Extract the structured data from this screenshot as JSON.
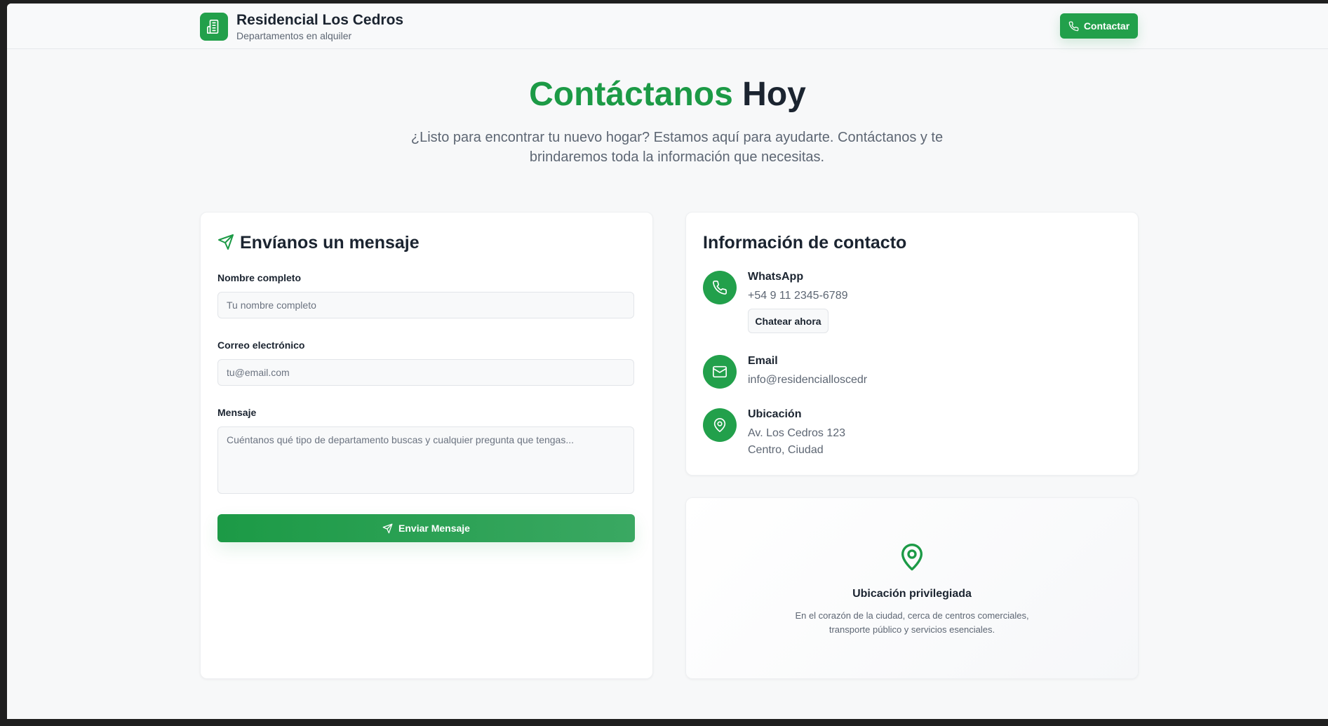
{
  "header": {
    "brand_title": "Residencial Los Cedros",
    "brand_subtitle": "Departamentos en alquiler",
    "contact_button": "Contactar"
  },
  "hero": {
    "title_green": "Contáctanos",
    "title_dark": "Hoy",
    "subtitle": "¿Listo para encontrar tu nuevo hogar? Estamos aquí para ayudarte. Contáctanos y te brindaremos toda la información que necesitas."
  },
  "form": {
    "title": "Envíanos un mensaje",
    "name_label": "Nombre completo",
    "name_placeholder": "Tu nombre completo",
    "email_label": "Correo electrónico",
    "email_placeholder": "tu@email.com",
    "message_label": "Mensaje",
    "message_placeholder": "Cuéntanos qué tipo de departamento buscas y cualquier pregunta que tengas...",
    "submit_label": "Enviar Mensaje"
  },
  "contact_info": {
    "title": "Información de contacto",
    "whatsapp_label": "WhatsApp",
    "whatsapp_value": "+54 9 11 2345-6789",
    "chat_button": "Chatear ahora",
    "email_label": "Email",
    "email_value": "info@residencialloscedr",
    "location_label": "Ubicación",
    "location_line1": "Av. Los Cedros 123",
    "location_line2": "Centro, Ciudad"
  },
  "location_card": {
    "title": "Ubicación privilegiada",
    "text": "En el corazón de la ciudad, cerca de centros comerciales, transporte público y servicios esenciales."
  },
  "colors": {
    "accent": "#22a04b",
    "title_green": "#1c9a46",
    "text_dark": "#1b2430",
    "text_muted": "#5d6673"
  },
  "icons": {
    "logo": "building-icon",
    "contact": "phone-icon",
    "send": "send-icon",
    "whatsapp": "phone-icon",
    "email": "mail-icon",
    "location": "map-pin-icon"
  }
}
